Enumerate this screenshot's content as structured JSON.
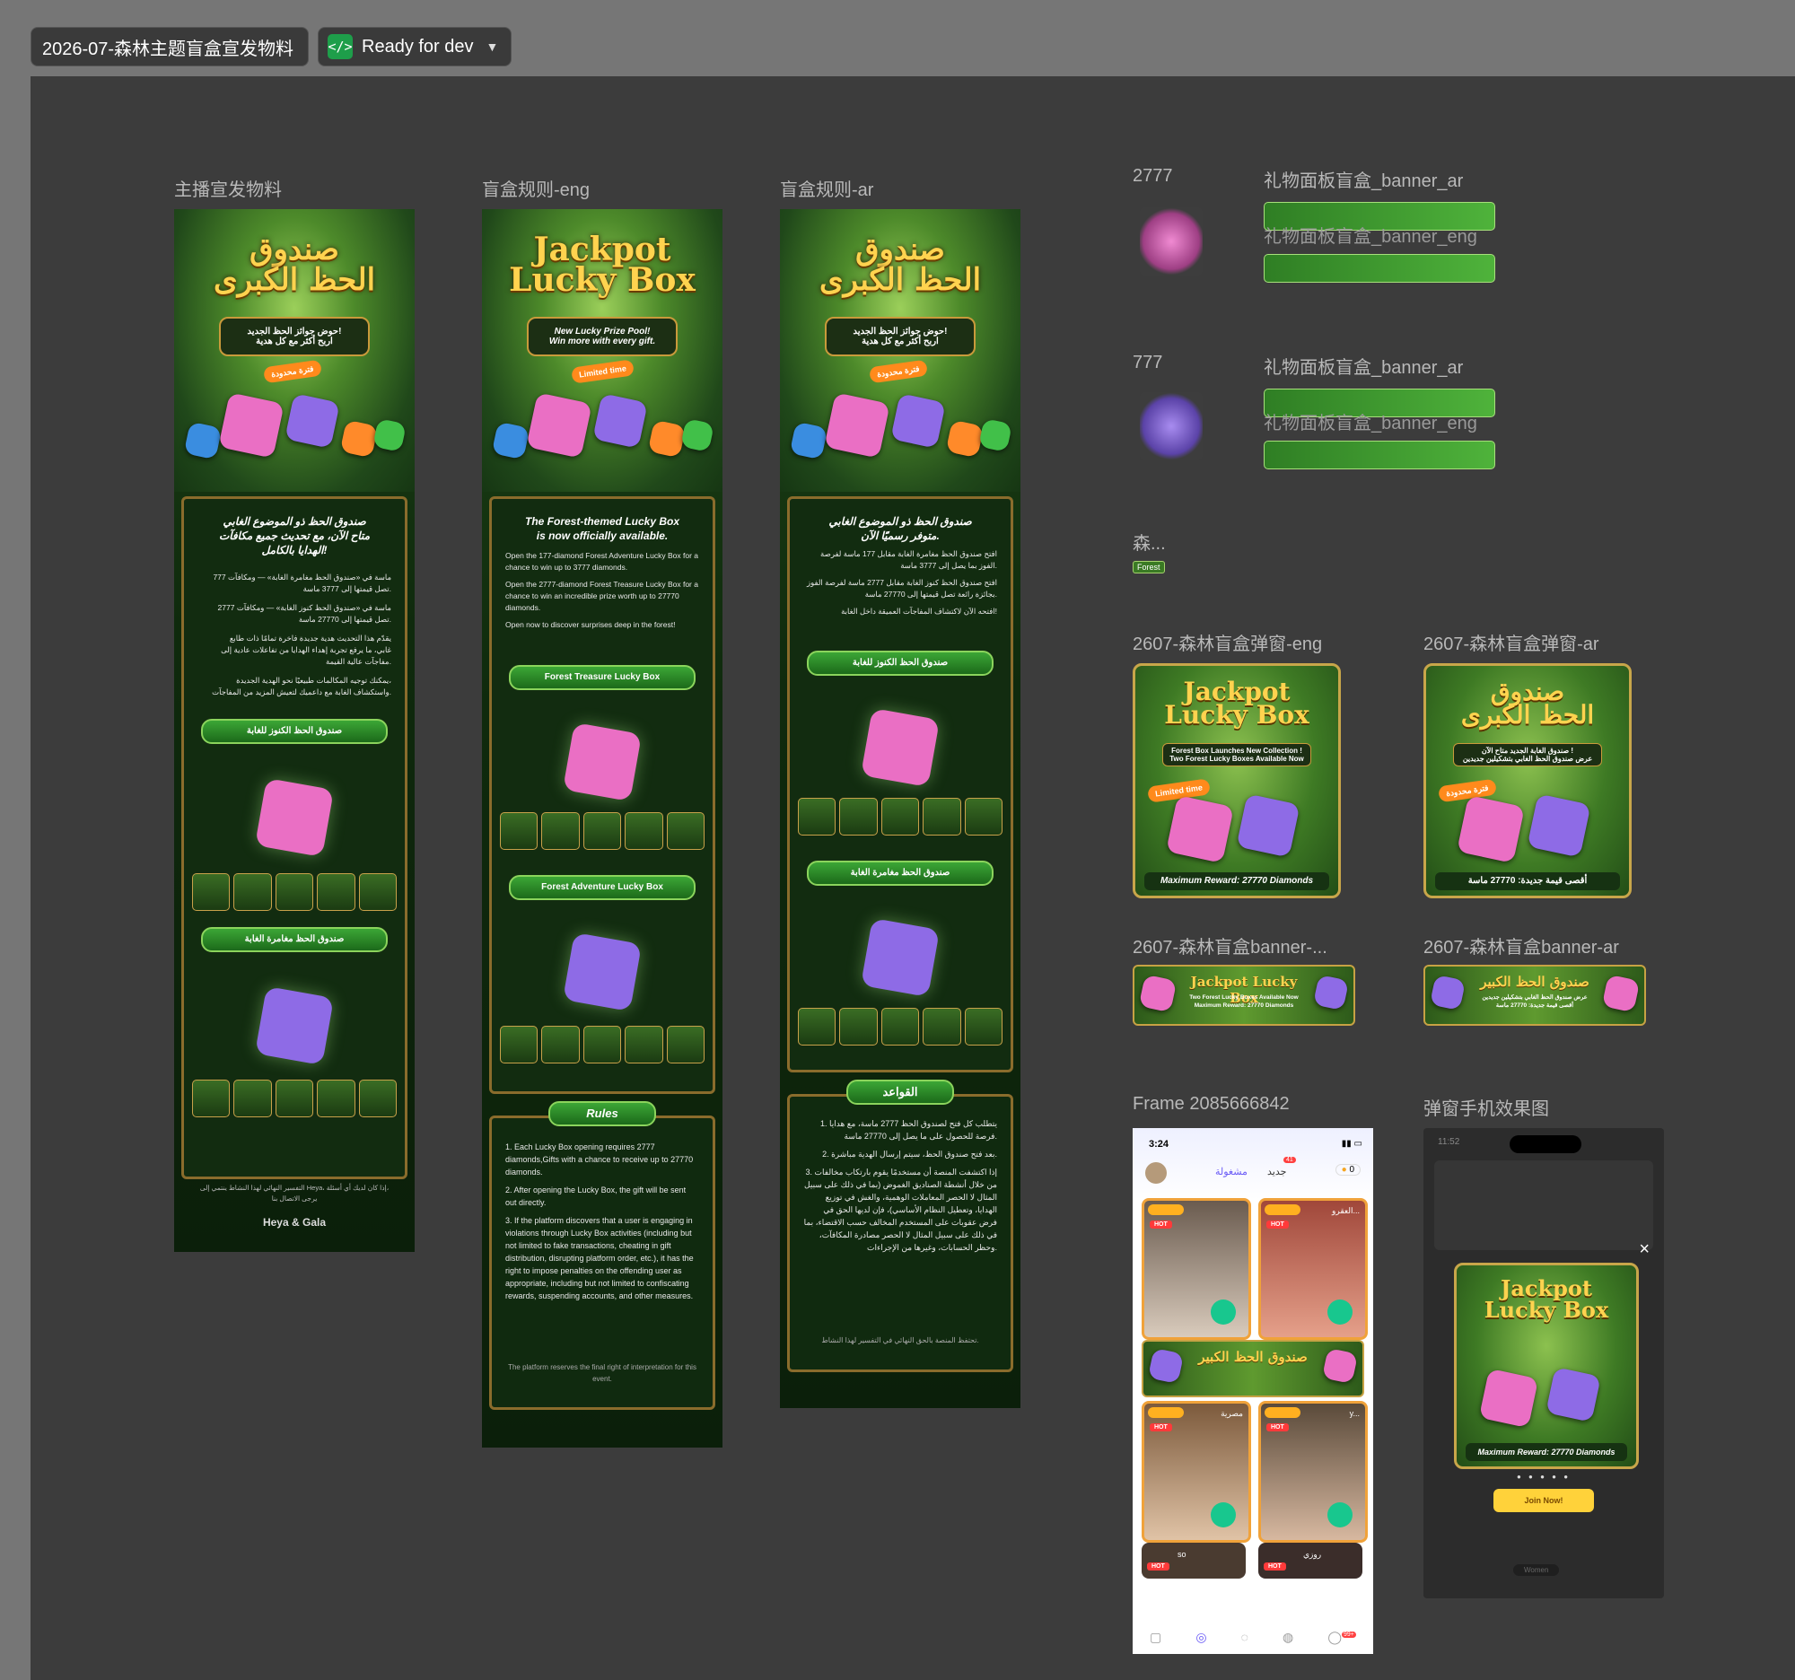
{
  "toolbar": {
    "file_title": "2026-07-森林主题盲盒宣发物料",
    "status": "Ready for dev",
    "status_icon": "code-icon",
    "dropdown_icon": "chevron-down-icon"
  },
  "frames": {
    "anchor": {
      "label": "主播宣发物料",
      "title_line1": "صندوق",
      "title_line2": "الحظ الكبرى",
      "subtitle_line1": "حوض جوائز الحظ الجديد!",
      "subtitle_line2": "اربح أكثر مع كل هدية",
      "tag": "فترة محدودة",
      "heading_line1": "صندوق الحظ ذو الموضوع الغابي",
      "heading_line2": "متاح الآن، مع تحديث جميع مكافآت",
      "heading_line3": "الهدايا بالكامل!",
      "para1_line1": "777 ماسة في «صندوق الحظ مغامرة الغابة» — ومكافآت",
      "para1_line2": "تصل قيمتها إلى 3777 ماسة.",
      "para2_line1": "2777 ماسة في «صندوق الحظ كنوز الغابة» — ومكافآت",
      "para2_line2": "تصل قيمتها إلى 27770 ماسة.",
      "para3_line1": "يقدّم هذا التحديث هدية جديدة فاخرة تمامًا ذات طابع",
      "para3_line2": "غابي، ما يرفع تجربة إهداء الهدايا من تفاعلات عادية إلى",
      "para3_line3": "مفاجآت عالية القيمة.",
      "para4_line1": "يمكنك توجيه المكالمات طبيعيًا نحو الهدية الجديدة،",
      "para4_line2": "واستكشاف الغابة مع داعميك لتعيش المزيد من المفاجآت.",
      "ribbon1": "صندوق الحظ الكنوز للغابة",
      "ribbon2": "صندوق الحظ مغامرة الغابة",
      "footer_line1": "التفسير النهائي لهذا النشاط ينتمي إلى Heya، إذا كان لديك أي أسئلة،",
      "footer_line2": "يرجى الاتصال بنا",
      "brand_heya": "Heya",
      "brand_amp": "&",
      "brand_gala": "Gala"
    },
    "rules_eng": {
      "label": "盲盒规则-eng",
      "title_line1": "Jackpot",
      "title_line2": "Lucky Box",
      "subtitle_line1": "New Lucky Prize Pool!",
      "subtitle_line2": "Win more with every gift.",
      "tag": "Limited time",
      "heading_line1": "The Forest-themed Lucky Box",
      "heading_line2": "is now officially available.",
      "para1": "Open the 177-diamond Forest Adventure Lucky Box for a chance to win up to 3777 diamonds.",
      "para2": "Open the 2777-diamond Forest Treasure Lucky Box for a chance to win an incredible prize worth up to 27770 diamonds.",
      "para3": "Open now to discover surprises deep in the forest!",
      "ribbon1": "Forest Treasure Lucky Box",
      "ribbon2": "Forest Adventure Lucky Box",
      "rules_title": "Rules",
      "rule1": "1. Each Lucky Box opening requires 2777 diamonds,Gifts with a chance to receive up to 27770 diamonds.",
      "rule2": "2. After opening the Lucky Box, the gift will be sent out directly.",
      "rule3": "3. If the platform discovers that a user is engaging in violations through Lucky Box activities (including but not limited to fake transactions, cheating in gift distribution, disrupting platform order, etc.), it has the right to impose penalties on the offending user as appropriate, including but not limited to confiscating rewards, suspending accounts, and other measures.",
      "rules_footer": "The platform reserves the final right of interpretation for this event."
    },
    "rules_ar": {
      "label": "盲盒规则-ar",
      "title_line1": "صندوق",
      "title_line2": "الحظ الكبرى",
      "subtitle_line1": "حوض جوائز الحظ الجديد!",
      "subtitle_line2": "اربح أكثر مع كل هدية",
      "tag": "فترة محدودة",
      "heading_line1": "صندوق الحظ ذو الموضوع الغابي",
      "heading_line2": "متوفر رسميًا الآن.",
      "para1": "افتح صندوق الحظ مغامرة الغابة مقابل 177 ماسة لفرصة الفوز بما يصل إلى 3777 ماسة.",
      "para2": "افتح صندوق الحظ كنوز الغابة مقابل 2777 ماسة لفرصة الفوز بجائزة رائعة تصل قيمتها إلى 27770 ماسة.",
      "para3": "افتحه الآن لاكتشاف المفاجآت العميقة داخل الغابة!",
      "ribbon1": "صندوق الحظ الكنوز للغابة",
      "ribbon2": "صندوق الحظ مغامرة الغابة",
      "rules_title": "القواعد",
      "rule1": "1. يتطلب كل فتح لصندوق الحظ 2777 ماسة، مع هدايا فرصة للحصول على ما يصل إلى 27770 ماسة.",
      "rule2": "2. بعد فتح صندوق الحظ، سيتم إرسال الهدية مباشرة.",
      "rule3": "3. إذا اكتشفت المنصة أن مستخدمًا يقوم بارتكاب مخالفات من خلال أنشطة الصناديق الغموض (بما في ذلك على سبيل المثال لا الحصر المعاملات الوهمية، والغش في توزيع الهدايا، وتعطيل النظام الأساسي)، فإن لديها الحق في فرض عقوبات على المستخدم المخالف حسب الاقتضاء، بما في ذلك على سبيل المثال لا الحصر مصادرة المكافآت، وحظر الحسابات، وغيرها من الإجراءات.",
      "rules_footer": "تحتفظ المنصة بالحق النهائي في التفسير لهذا النشاط."
    },
    "gift_2777": {
      "label": "2777"
    },
    "gift_777": {
      "label": "777"
    },
    "panel_banner_ar_1": {
      "label": "礼物面板盲盒_banner_ar"
    },
    "panel_banner_eng_1": {
      "label": "礼物面板盲盒_banner_eng"
    },
    "panel_banner_ar_2": {
      "label": "礼物面板盲盒_banner_ar"
    },
    "panel_banner_eng_2": {
      "label": "礼物面板盲盒_banner_eng"
    },
    "forest_small": {
      "label": "森...",
      "tag": "Forest"
    },
    "popup_eng": {
      "label": "2607-森林盲盒弹窗-eng",
      "title_line1": "Jackpot",
      "title_line2": "Lucky Box",
      "sub_line1": "Forest Box Launches New Collection !",
      "sub_line2": "Two Forest Lucky Boxes Available Now",
      "tag": "Limited time",
      "footer": "Maximum Reward: 27770 Diamonds"
    },
    "popup_ar": {
      "label": "2607-森林盲盒弹窗-ar",
      "title_line1": "صندوق",
      "title_line2": "الحظ الكبرى",
      "sub_line1": "صندوق الغابة الجديد متاح الآن !",
      "sub_line2": "عرض صندوق الحظ الغابي بتشكيلين جديدين",
      "tag": "فترة محدودة",
      "footer": "أقصى قيمة جديدة: 27770 ماسة"
    },
    "banner_eng": {
      "label": "2607-森林盲盒banner-...",
      "title": "Jackpot Lucky Box",
      "line1": "Two Forest Lucky Boxes Available Now",
      "line2": "Maximum Reward: 27770 Diamonds"
    },
    "banner_ar": {
      "label": "2607-森林盲盒banner-ar",
      "title": "صندوق الحظ الكبير",
      "line1": "عرض صندوق الحظ الغابي بتشكيلين جديدين",
      "line2": "أقصى قيمة جديدة: 27770 ماسة"
    },
    "phone_frame": {
      "label": "Frame 2085666842",
      "time": "3:24",
      "tab_busy": "مشغولة",
      "tab_new": "جديد",
      "new_badge": "41",
      "coins": "0",
      "hot": "HOT",
      "card2_name": "العقرو...",
      "card3_name": "مصرية",
      "card4_name": "y...",
      "card5_name": "so",
      "card6_name": "روزي",
      "banner_title": "صندوق الحظ الكبير",
      "badge_99": "99+"
    },
    "phone_popup": {
      "label": "弹窗手机效果图",
      "time": "11:52",
      "title_line1": "Jackpot",
      "title_line2": "Lucky Box",
      "footer": "Maximum Reward: 27770 Diamonds",
      "join_button": "Join Now!",
      "close_icon": "×",
      "chip": "Women"
    }
  },
  "colors": {
    "canvas": "#3c3c3c",
    "page": "#767676",
    "ready_green": "#1e9e4a",
    "gold": "#ffd34f",
    "forest_dark": "#0f2a0d",
    "join_yellow": "#ffd23a"
  }
}
